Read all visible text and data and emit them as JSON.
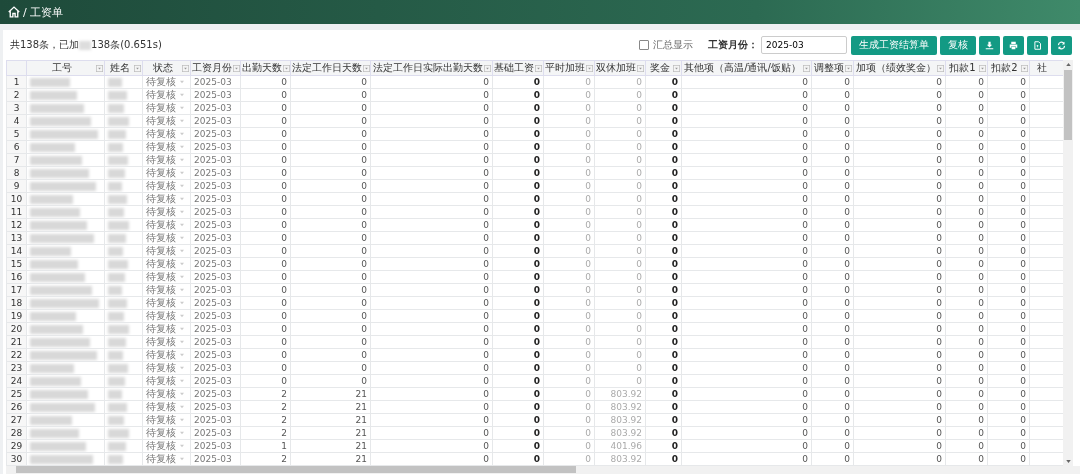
{
  "breadcrumb": {
    "separator": "/",
    "title": "工资单"
  },
  "summary": {
    "before": "共138条，已加",
    "after": "138条(0.651s)"
  },
  "toolbar": {
    "summary_toggle": {
      "label": "汇总显示",
      "checked": false
    },
    "month_label": "工资月份：",
    "month_value": "2025-03",
    "buttons": [
      {
        "kind": "text",
        "label": "生成工资结算单"
      },
      {
        "kind": "text",
        "label": "复核"
      },
      {
        "kind": "download"
      },
      {
        "kind": "print"
      },
      {
        "kind": "export"
      },
      {
        "kind": "refresh"
      }
    ]
  },
  "table": {
    "columns": [
      {
        "label": "工号",
        "kind": "redacted"
      },
      {
        "label": "姓名",
        "kind": "redacted"
      },
      {
        "label": "状态",
        "kind": "status"
      },
      {
        "label": "工资月份",
        "kind": "text"
      },
      {
        "label": "出勤天数",
        "kind": "number"
      },
      {
        "label": "法定工作日天数",
        "kind": "number"
      },
      {
        "label": "法定工作日实际出勤天数",
        "kind": "number"
      },
      {
        "label": "基础工资",
        "kind": "bold"
      },
      {
        "label": "平时加班",
        "kind": "light"
      },
      {
        "label": "双休加班",
        "kind": "light"
      },
      {
        "label": "奖金",
        "kind": "bold"
      },
      {
        "label": "其他项（高温/通讯/饭贴）",
        "kind": "number"
      },
      {
        "label": "调整项",
        "kind": "number"
      },
      {
        "label": "加项（绩效奖金）",
        "kind": "number"
      },
      {
        "label": "扣款1",
        "kind": "number"
      },
      {
        "label": "扣款2",
        "kind": "number"
      },
      {
        "label": "社",
        "kind": "cut"
      }
    ],
    "rows": [
      {
        "no": "1",
        "cells": [
          "",
          "",
          "待复核",
          "2025-03",
          "0",
          "0",
          "0",
          "0",
          "0",
          "0",
          "0",
          "0",
          "0",
          "0",
          "0",
          "0",
          ""
        ]
      },
      {
        "no": "2",
        "cells": [
          "",
          "",
          "待复核",
          "2025-03",
          "0",
          "0",
          "0",
          "0",
          "0",
          "0",
          "0",
          "0",
          "0",
          "0",
          "0",
          "0",
          ""
        ]
      },
      {
        "no": "3",
        "cells": [
          "",
          "",
          "待复核",
          "2025-03",
          "0",
          "0",
          "0",
          "0",
          "0",
          "0",
          "0",
          "0",
          "0",
          "0",
          "0",
          "0",
          ""
        ]
      },
      {
        "no": "4",
        "cells": [
          "",
          "",
          "待复核",
          "2025-03",
          "0",
          "0",
          "0",
          "0",
          "0",
          "0",
          "0",
          "0",
          "0",
          "0",
          "0",
          "0",
          ""
        ]
      },
      {
        "no": "5",
        "cells": [
          "",
          "",
          "待复核",
          "2025-03",
          "0",
          "0",
          "0",
          "0",
          "0",
          "0",
          "0",
          "0",
          "0",
          "0",
          "0",
          "0",
          ""
        ]
      },
      {
        "no": "6",
        "cells": [
          "",
          "",
          "待复核",
          "2025-03",
          "0",
          "0",
          "0",
          "0",
          "0",
          "0",
          "0",
          "0",
          "0",
          "0",
          "0",
          "0",
          ""
        ]
      },
      {
        "no": "7",
        "cells": [
          "",
          "",
          "待复核",
          "2025-03",
          "0",
          "0",
          "0",
          "0",
          "0",
          "0",
          "0",
          "0",
          "0",
          "0",
          "0",
          "0",
          ""
        ]
      },
      {
        "no": "8",
        "cells": [
          "",
          "",
          "待复核",
          "2025-03",
          "0",
          "0",
          "0",
          "0",
          "0",
          "0",
          "0",
          "0",
          "0",
          "0",
          "0",
          "0",
          ""
        ]
      },
      {
        "no": "9",
        "cells": [
          "",
          "",
          "待复核",
          "2025-03",
          "0",
          "0",
          "0",
          "0",
          "0",
          "0",
          "0",
          "0",
          "0",
          "0",
          "0",
          "0",
          ""
        ]
      },
      {
        "no": "10",
        "cells": [
          "",
          "",
          "待复核",
          "2025-03",
          "0",
          "0",
          "0",
          "0",
          "0",
          "0",
          "0",
          "0",
          "0",
          "0",
          "0",
          "0",
          ""
        ]
      },
      {
        "no": "11",
        "cells": [
          "",
          "",
          "待复核",
          "2025-03",
          "0",
          "0",
          "0",
          "0",
          "0",
          "0",
          "0",
          "0",
          "0",
          "0",
          "0",
          "0",
          ""
        ]
      },
      {
        "no": "12",
        "cells": [
          "",
          "",
          "待复核",
          "2025-03",
          "0",
          "0",
          "0",
          "0",
          "0",
          "0",
          "0",
          "0",
          "0",
          "0",
          "0",
          "0",
          ""
        ]
      },
      {
        "no": "13",
        "cells": [
          "",
          "",
          "待复核",
          "2025-03",
          "0",
          "0",
          "0",
          "0",
          "0",
          "0",
          "0",
          "0",
          "0",
          "0",
          "0",
          "0",
          ""
        ]
      },
      {
        "no": "14",
        "cells": [
          "",
          "",
          "待复核",
          "2025-03",
          "0",
          "0",
          "0",
          "0",
          "0",
          "0",
          "0",
          "0",
          "0",
          "0",
          "0",
          "0",
          ""
        ]
      },
      {
        "no": "15",
        "cells": [
          "",
          "",
          "待复核",
          "2025-03",
          "0",
          "0",
          "0",
          "0",
          "0",
          "0",
          "0",
          "0",
          "0",
          "0",
          "0",
          "0",
          ""
        ]
      },
      {
        "no": "16",
        "cells": [
          "",
          "",
          "待复核",
          "2025-03",
          "0",
          "0",
          "0",
          "0",
          "0",
          "0",
          "0",
          "0",
          "0",
          "0",
          "0",
          "0",
          ""
        ]
      },
      {
        "no": "17",
        "cells": [
          "",
          "",
          "待复核",
          "2025-03",
          "0",
          "0",
          "0",
          "0",
          "0",
          "0",
          "0",
          "0",
          "0",
          "0",
          "0",
          "0",
          ""
        ]
      },
      {
        "no": "18",
        "cells": [
          "",
          "",
          "待复核",
          "2025-03",
          "0",
          "0",
          "0",
          "0",
          "0",
          "0",
          "0",
          "0",
          "0",
          "0",
          "0",
          "0",
          ""
        ]
      },
      {
        "no": "19",
        "cells": [
          "",
          "",
          "待复核",
          "2025-03",
          "0",
          "0",
          "0",
          "0",
          "0",
          "0",
          "0",
          "0",
          "0",
          "0",
          "0",
          "0",
          ""
        ]
      },
      {
        "no": "20",
        "cells": [
          "",
          "",
          "待复核",
          "2025-03",
          "0",
          "0",
          "0",
          "0",
          "0",
          "0",
          "0",
          "0",
          "0",
          "0",
          "0",
          "0",
          ""
        ]
      },
      {
        "no": "21",
        "cells": [
          "",
          "",
          "待复核",
          "2025-03",
          "0",
          "0",
          "0",
          "0",
          "0",
          "0",
          "0",
          "0",
          "0",
          "0",
          "0",
          "0",
          ""
        ]
      },
      {
        "no": "22",
        "cells": [
          "",
          "",
          "待复核",
          "2025-03",
          "0",
          "0",
          "0",
          "0",
          "0",
          "0",
          "0",
          "0",
          "0",
          "0",
          "0",
          "0",
          ""
        ]
      },
      {
        "no": "23",
        "cells": [
          "",
          "",
          "待复核",
          "2025-03",
          "0",
          "0",
          "0",
          "0",
          "0",
          "0",
          "0",
          "0",
          "0",
          "0",
          "0",
          "0",
          ""
        ]
      },
      {
        "no": "24",
        "cells": [
          "",
          "",
          "待复核",
          "2025-03",
          "0",
          "0",
          "0",
          "0",
          "0",
          "0",
          "0",
          "0",
          "0",
          "0",
          "0",
          "0",
          ""
        ]
      },
      {
        "no": "25",
        "cells": [
          "",
          "",
          "待复核",
          "2025-03",
          "2",
          "21",
          "0",
          "0",
          "0",
          "803.92",
          "0",
          "0",
          "0",
          "0",
          "0",
          "0",
          ""
        ]
      },
      {
        "no": "26",
        "cells": [
          "",
          "",
          "待复核",
          "2025-03",
          "2",
          "21",
          "0",
          "0",
          "0",
          "803.92",
          "0",
          "0",
          "0",
          "0",
          "0",
          "0",
          ""
        ]
      },
      {
        "no": "27",
        "cells": [
          "",
          "",
          "待复核",
          "2025-03",
          "2",
          "21",
          "0",
          "0",
          "0",
          "803.92",
          "0",
          "0",
          "0",
          "0",
          "0",
          "0",
          ""
        ]
      },
      {
        "no": "28",
        "cells": [
          "",
          "",
          "待复核",
          "2025-03",
          "2",
          "21",
          "0",
          "0",
          "0",
          "803.92",
          "0",
          "0",
          "0",
          "0",
          "0",
          "0",
          ""
        ]
      },
      {
        "no": "29",
        "cells": [
          "",
          "",
          "待复核",
          "2025-03",
          "1",
          "21",
          "0",
          "0",
          "0",
          "401.96",
          "0",
          "0",
          "0",
          "0",
          "0",
          "0",
          ""
        ]
      },
      {
        "no": "30",
        "cells": [
          "",
          "",
          "待复核",
          "2025-03",
          "2",
          "21",
          "0",
          "0",
          "0",
          "803.92",
          "0",
          "0",
          "0",
          "0",
          "0",
          "0",
          ""
        ]
      }
    ]
  }
}
